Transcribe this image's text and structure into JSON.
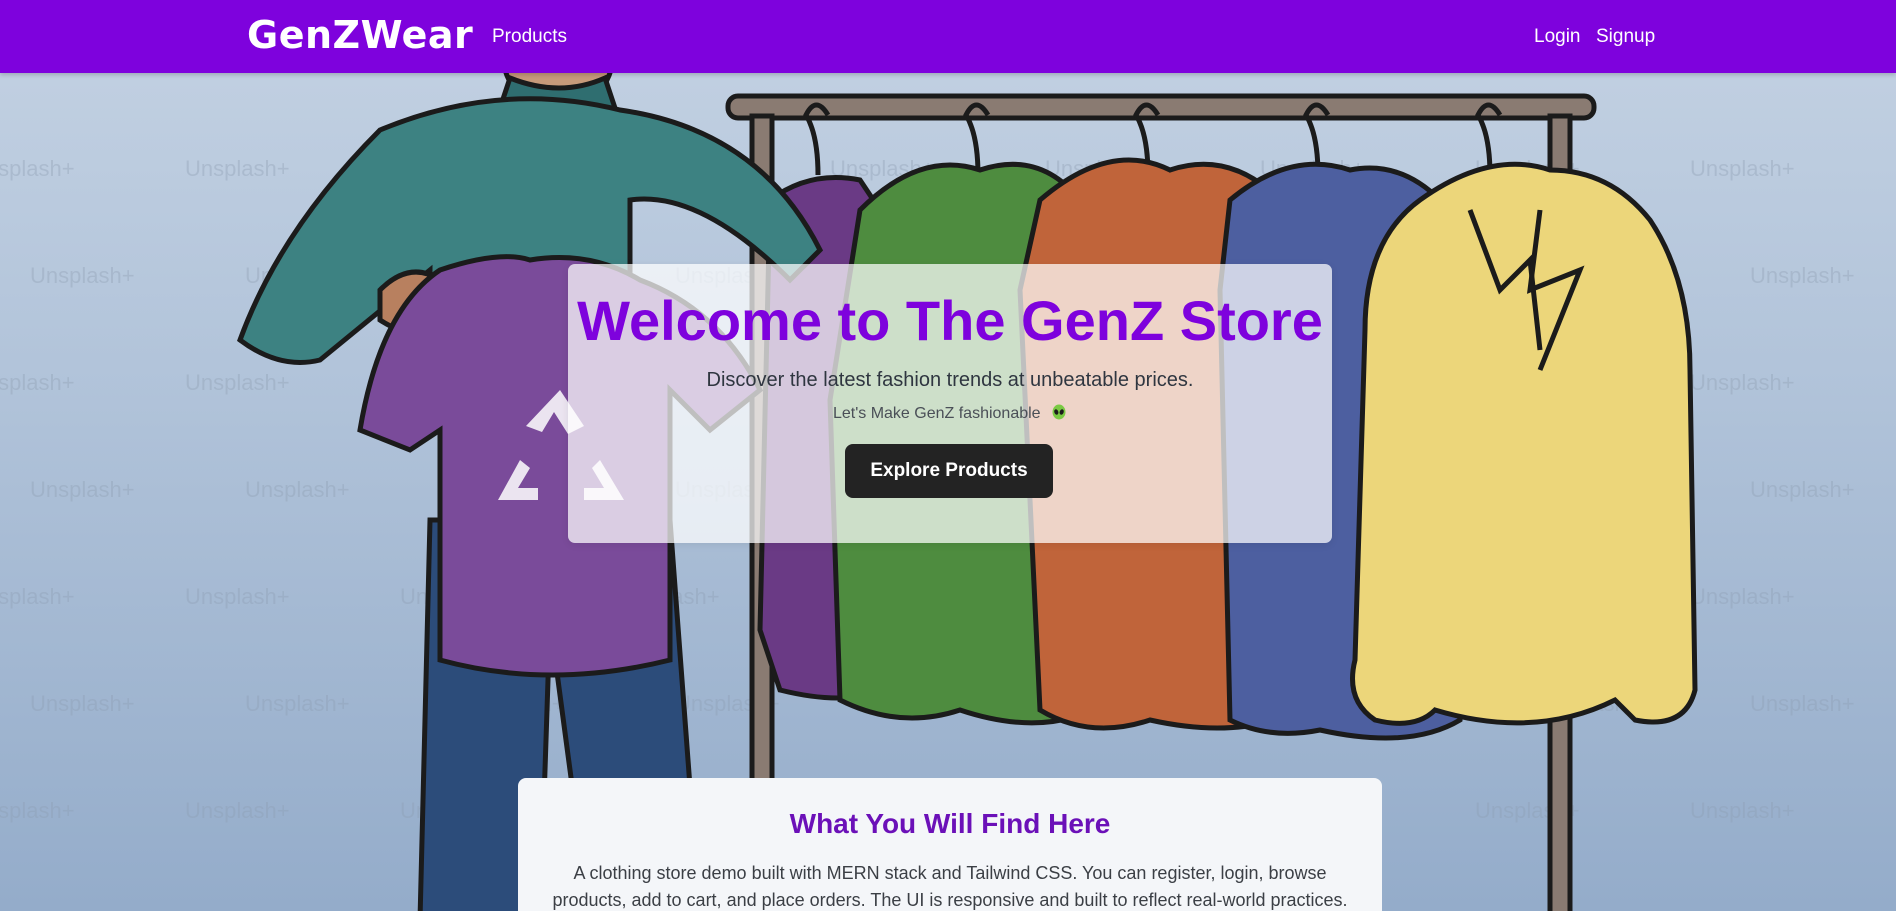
{
  "navbar": {
    "brand": "GenZWear",
    "products_label": "Products",
    "login_label": "Login",
    "signup_label": "Signup",
    "background_color": "#7e02dd"
  },
  "hero": {
    "title": "Welcome to The GenZ Store",
    "subtitle": "Discover the latest fashion trends at unbeatable prices.",
    "tagline": "Let's Make GenZ fashionable",
    "tagline_icon": "alien-emoji-icon",
    "cta_label": "Explore Products",
    "watermark_text": "Unsplash+"
  },
  "info": {
    "title": "What You Will Find Here",
    "body": "A clothing store demo built with MERN stack and Tailwind CSS. You can register, login, browse products, add to cart, and place orders. The UI is responsive and built to reflect real-world practices."
  },
  "colors": {
    "accent": "#7e02dd",
    "button": "#232323",
    "card": "#f4f6f9"
  }
}
